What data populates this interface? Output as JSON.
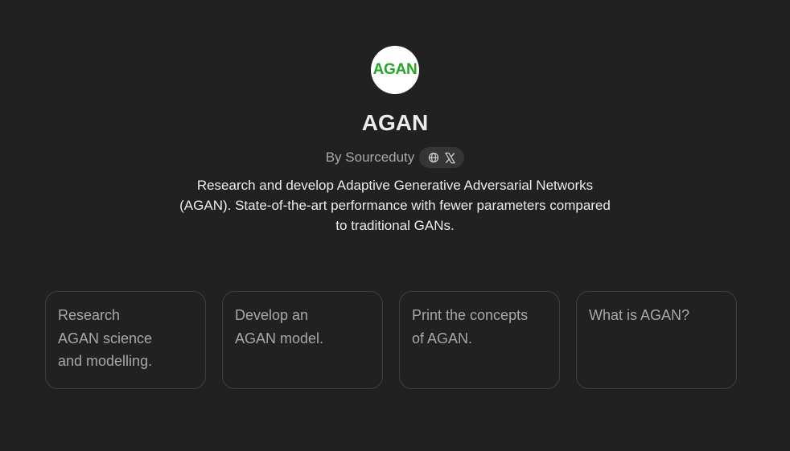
{
  "gpt": {
    "avatar_text": "AGAN",
    "title": "AGAN",
    "byline": "By Sourceduty",
    "description_lines": [
      "Research and develop Adaptive Generative Adversarial Networks",
      "(AGAN). State-of-the-art performance with fewer parameters compared",
      "to traditional GANs."
    ],
    "social_icons": [
      "globe-icon",
      "x-logo-icon"
    ]
  },
  "prompt_cards": [
    {
      "lines": [
        "Research",
        "AGAN science",
        "and modelling."
      ]
    },
    {
      "lines": [
        "Develop an",
        "AGAN model."
      ]
    },
    {
      "lines": [
        "Print the concepts",
        "of AGAN."
      ]
    },
    {
      "lines": [
        "What is AGAN?"
      ]
    }
  ],
  "colors": {
    "background": "#212121",
    "avatar_text": "#26a526",
    "muted_text": "#a8a8a8",
    "card_border": "#3f3f3f"
  }
}
